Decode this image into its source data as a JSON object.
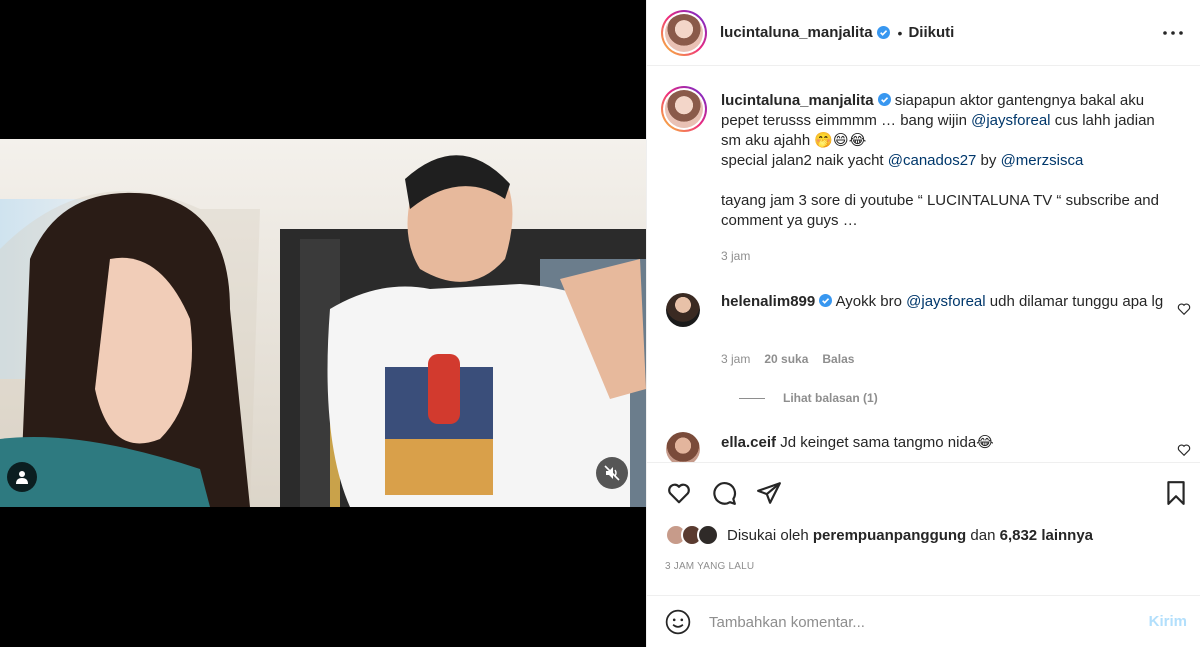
{
  "post": {
    "username": "lucintaluna_manjalita",
    "follow_status": "Diikuti",
    "dot": "•",
    "caption": {
      "part1": "siapapun aktor gantengnya bakal aku pepet terusss eimmmm … bang wijin ",
      "mention1": "@jaysforeal",
      "part2": " cus lahh jadian sm aku ajahh 🤭😄😂",
      "line2_prefix": "special jalan2 naik yacht ",
      "mention2": "@canados27",
      "line2_mid": " by ",
      "mention3": "@merzsisca",
      "line3": "tayang jam 3 sore di youtube “ LUCINTALUNA TV “ subscribe and comment ya guys …",
      "time": "3 jam"
    },
    "comments": [
      {
        "username": "helenalim899",
        "text_prefix": "Ayokk bro ",
        "mention": "@jaysforeal",
        "text_suffix": " udh dilamar tunggu apa lg",
        "time": "3 jam",
        "likes": "20 suka",
        "reply_label": "Balas",
        "view_replies": "Lihat balasan (1)"
      },
      {
        "username": "ella.ceif",
        "text": "Jd keinget sama tangmo nida😂"
      }
    ],
    "likes": {
      "prefix": "Disukai oleh",
      "liker": "perempuanpanggung",
      "conj": "dan",
      "count": "6,832 lainnya"
    },
    "time_ago": "3 JAM YANG LALU",
    "add_comment": {
      "placeholder": "Tambahkan komentar...",
      "post_label": "Kirim"
    }
  },
  "icons": {
    "verified": "verified-badge-icon",
    "more": "more-options-icon",
    "like": "heart-icon",
    "comment": "comment-bubble-icon",
    "share": "paper-plane-icon",
    "save": "bookmark-icon",
    "emoji": "smiley-icon",
    "mute": "speaker-muted-icon",
    "tag": "user-tag-icon"
  },
  "colors": {
    "link": "#00376b",
    "verified": "#3897f0",
    "muted": "#8e8e8e",
    "post_disabled": "#b2dffc"
  }
}
